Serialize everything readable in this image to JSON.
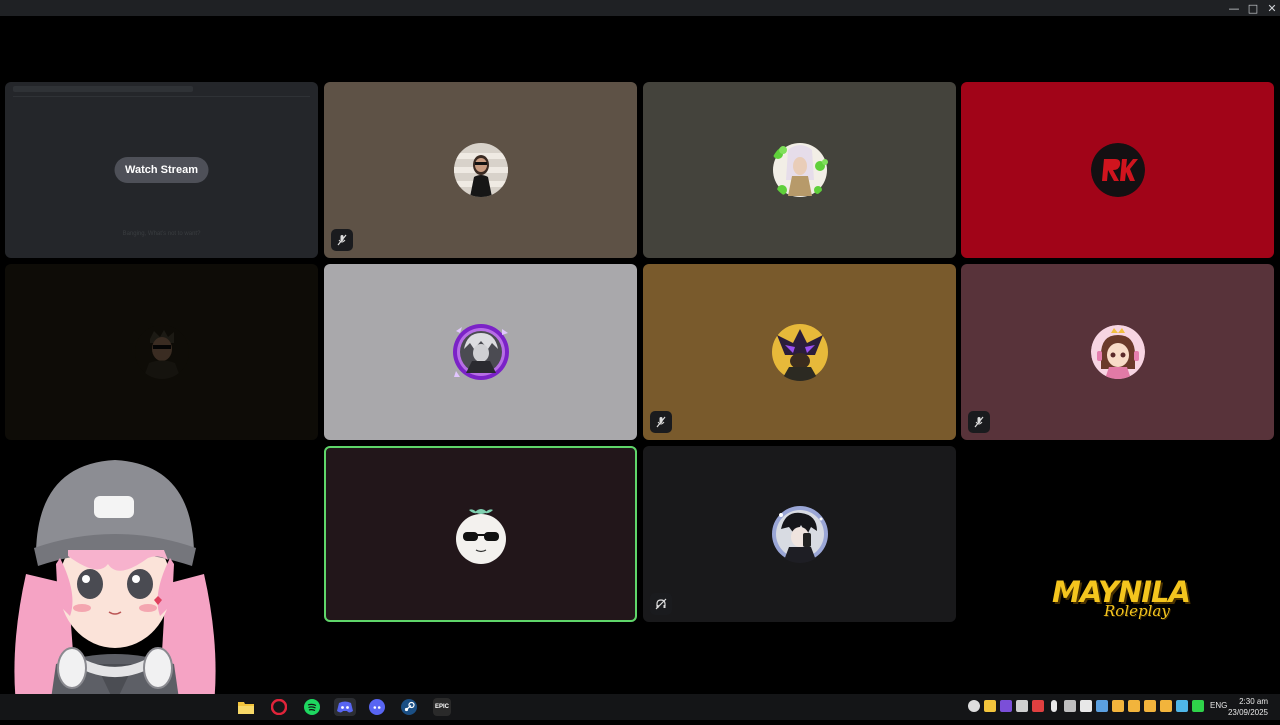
{
  "window": {
    "controls": {
      "minimize": "—",
      "maximize": "□",
      "close": "✕"
    }
  },
  "stage": {
    "stream_tile": {
      "watch_label": "Watch Stream",
      "caption": "Banging, What's not to want?",
      "background": "#24262a"
    },
    "tiles": [
      {
        "id": "tile-1",
        "bg": "#5e5246",
        "muted": true,
        "avatar": "woman-sunglasses",
        "speaking": false
      },
      {
        "id": "tile-2",
        "bg": "#44433c",
        "muted": false,
        "avatar": "clover-frame-character",
        "speaking": false
      },
      {
        "id": "tile-3",
        "bg": "#a10418",
        "muted": false,
        "avatar": "rk-logo",
        "speaking": false
      },
      {
        "id": "tile-4",
        "bg": "#0e0c07",
        "muted": false,
        "avatar": "man-sunglasses",
        "speaking": false
      },
      {
        "id": "tile-5",
        "bg": "#a9a8ab",
        "muted": false,
        "avatar": "purple-glow-character",
        "speaking": false
      },
      {
        "id": "tile-6",
        "bg": "#795a2c",
        "muted": true,
        "avatar": "masked-character",
        "speaking": false
      },
      {
        "id": "tile-7",
        "bg": "#58333a",
        "muted": true,
        "avatar": "anime-girl-crown",
        "speaking": false
      },
      {
        "id": "tile-8",
        "bg": "#22161a",
        "muted": false,
        "avatar": "mochi-sunglasses",
        "speaking": true
      },
      {
        "id": "tile-9",
        "bg": "#19191b",
        "muted": true,
        "avatar": "anime-boy-phone",
        "speaking": false
      }
    ],
    "speaking_color": "#5fd66a"
  },
  "overlay": {
    "logo_main": "MAYNILA",
    "logo_sub": "Roleplay",
    "logo_color": "#f4c51e",
    "vtuber": "pink-haired-vtuber-beanie"
  },
  "taskbar": {
    "apps": [
      "file-explorer-icon",
      "opera-icon",
      "spotify-icon",
      "discord-icon",
      "discord-alt-icon",
      "steam-icon",
      "epic-games-icon"
    ],
    "epic_label": "EPIC",
    "language": "ENG",
    "time": "2:30 am",
    "date": "23/09/2025"
  }
}
